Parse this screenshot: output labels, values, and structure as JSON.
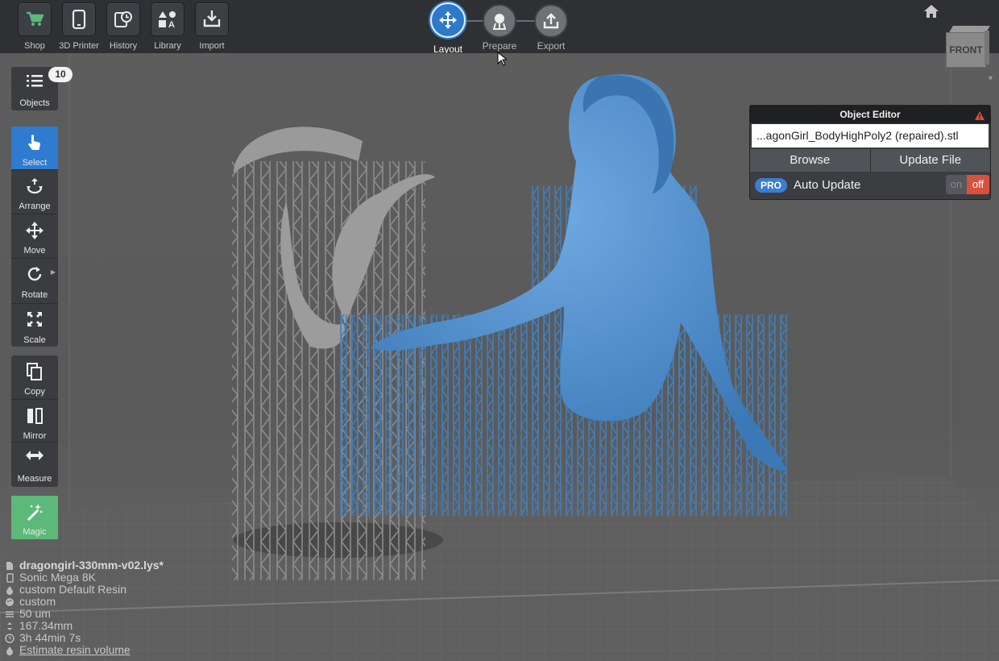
{
  "toolbar": {
    "shop": "Shop",
    "printer": "3D Printer",
    "history": "History",
    "library": "Library",
    "import": "Import"
  },
  "workflow": {
    "layout": "Layout",
    "prepare": "Prepare",
    "export": "Export"
  },
  "viewcube": {
    "face": "FRONT"
  },
  "objects": {
    "label": "Objects",
    "count": "10"
  },
  "tools": {
    "select": "Select",
    "arrange": "Arrange",
    "move": "Move",
    "rotate": "Rotate",
    "scale": "Scale",
    "copy": "Copy",
    "mirror": "Mirror",
    "measure": "Measure",
    "magic": "Magic"
  },
  "editor": {
    "title": "Object Editor",
    "filename": "...agonGirl_BodyHighPoly2 (repaired).stl",
    "browse": "Browse",
    "update_file": "Update File",
    "pro": "PRO",
    "auto_update": "Auto Update",
    "on": "on",
    "off": "off"
  },
  "info": {
    "project": "dragongirl-330mm-v02.lys*",
    "printer": "Sonic Mega 8K",
    "resin": "custom Default Resin",
    "profile": "custom",
    "layer": "50 um",
    "height": "167.34mm",
    "time": "3h 44min 7s",
    "estimate": "Estimate resin volume"
  },
  "colors": {
    "accent": "#2f7bd0",
    "model_blue": "#4a8ccc",
    "supports_gray": "#8d8d8d",
    "magic_green": "#5db97a",
    "toggle_off": "#d9513c"
  }
}
